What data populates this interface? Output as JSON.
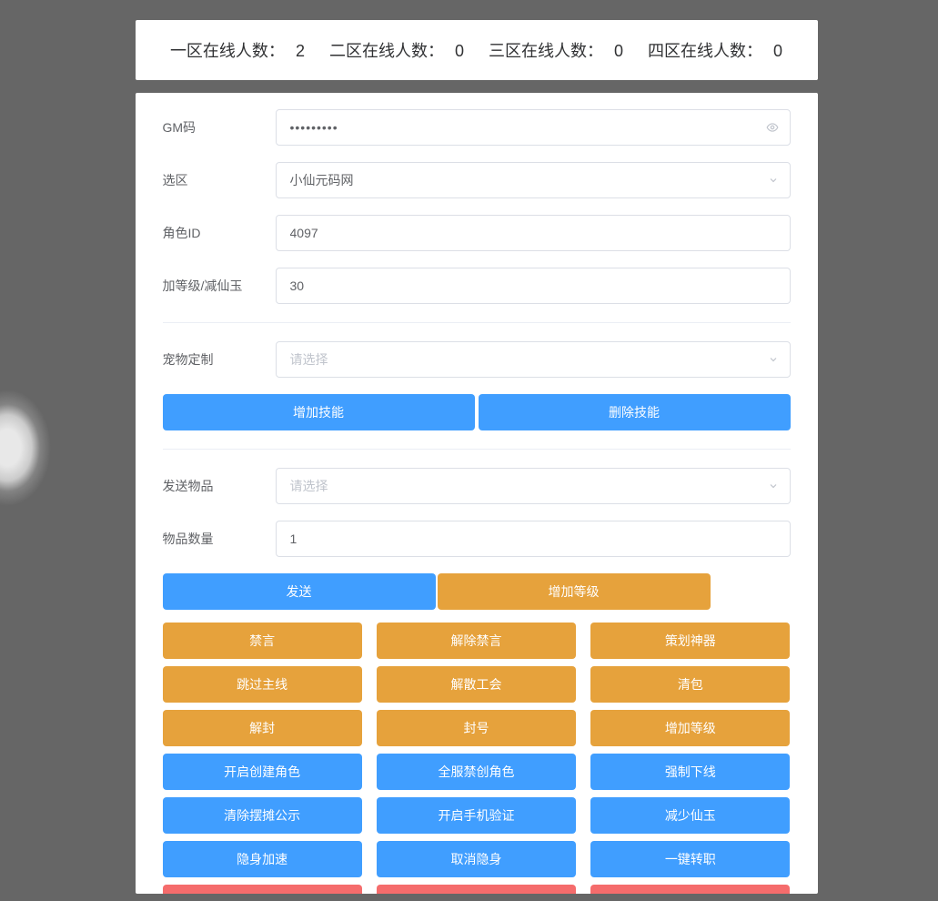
{
  "header": {
    "zone1_label": "一区在线人数：",
    "zone1_count": "2",
    "zone2_label": "二区在线人数：",
    "zone2_count": "0",
    "zone3_label": "三区在线人数：",
    "zone3_count": "0",
    "zone4_label": "四区在线人数：",
    "zone4_count": "0"
  },
  "form": {
    "gm_code_label": "GM码",
    "gm_code_value": "•••••••••",
    "zone_label": "选区",
    "zone_value": "小仙元码网",
    "role_id_label": "角色ID",
    "role_id_value": "4097",
    "level_label": "加等级/减仙玉",
    "level_value": "30",
    "pet_custom_label": "宠物定制",
    "pet_placeholder": "请选择",
    "send_item_label": "发送物品",
    "send_item_placeholder": "请选择",
    "item_count_label": "物品数量",
    "item_count_value": "1"
  },
  "buttons": {
    "add_skill": "增加技能",
    "del_skill": "删除技能",
    "send": "发送",
    "add_level_top": "增加等级",
    "row1": [
      "禁言",
      "解除禁言",
      "策划神器"
    ],
    "row2": [
      "跳过主线",
      "解散工会",
      "清包"
    ],
    "row3": [
      "解封",
      "封号",
      "增加等级"
    ],
    "row4": [
      "开启创建角色",
      "全服禁创角色",
      "强制下线"
    ],
    "row5": [
      "清除摆摊公示",
      "开启手机验证",
      "减少仙玉"
    ],
    "row6": [
      "隐身加速",
      "取消隐身",
      "一键转职"
    ]
  }
}
